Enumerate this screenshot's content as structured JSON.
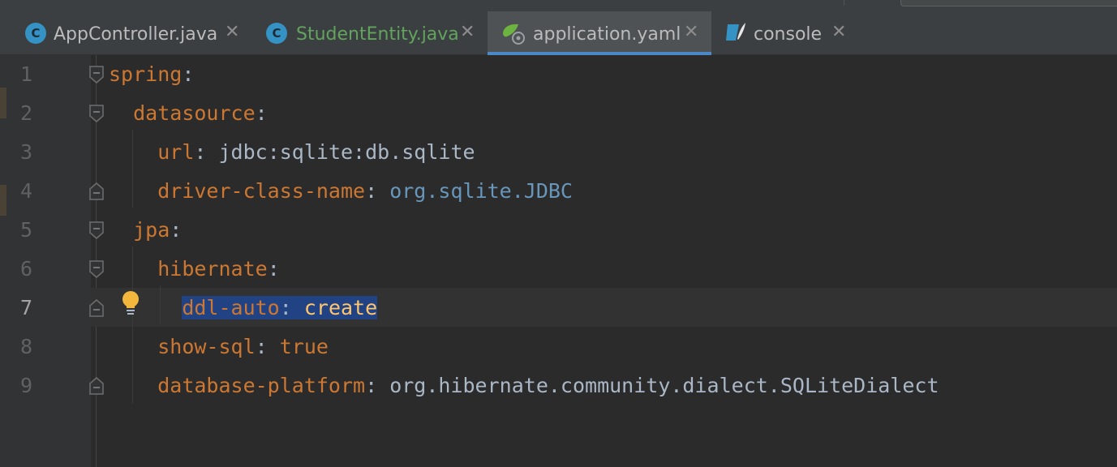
{
  "tabs": [
    {
      "label": "AppController.java",
      "icon": "java-class-icon",
      "color": "#bbbbbb"
    },
    {
      "label": "StudentEntity.java",
      "icon": "java-class-icon",
      "color": "#62a35d"
    },
    {
      "label": "application.yaml",
      "icon": "spring-config-icon",
      "color": "#bbbbbb"
    },
    {
      "label": "console",
      "icon": "sql-console-icon",
      "color": "#bbbbbb"
    }
  ],
  "class_icon_letter": "C",
  "close_glyph": "✕",
  "editor": {
    "current_line": 7,
    "line_numbers": [
      "1",
      "2",
      "3",
      "4",
      "5",
      "6",
      "7",
      "8",
      "9"
    ],
    "lines": [
      {
        "key": "spring",
        "colon": ":",
        "value": ""
      },
      {
        "key": "datasource",
        "colon": ":",
        "value": ""
      },
      {
        "key": "url",
        "colon": ": ",
        "value": "jdbc:sqlite:db.sqlite"
      },
      {
        "key": "driver-class-name",
        "colon": ": ",
        "value_pkg1": "org.",
        "value_pkg2": "sqlite.",
        "value_cls": "JDBC"
      },
      {
        "key": "jpa",
        "colon": ":",
        "value": ""
      },
      {
        "key": "hibernate",
        "colon": ":",
        "value": ""
      },
      {
        "key": "ddl-auto",
        "colon": ": ",
        "value": "create"
      },
      {
        "key": "show-sql",
        "colon": ": ",
        "value": "true"
      },
      {
        "key": "database-platform",
        "colon": ": ",
        "value": "org.hibernate.community.dialect.SQLiteDialect"
      }
    ]
  },
  "colors": {
    "key": "#cc7832",
    "value": "#a9b7c6",
    "class_ref": "#6897bb",
    "selection": "#214283",
    "tab_underline": "#4a88c7",
    "bulb": "#f4b73d"
  }
}
